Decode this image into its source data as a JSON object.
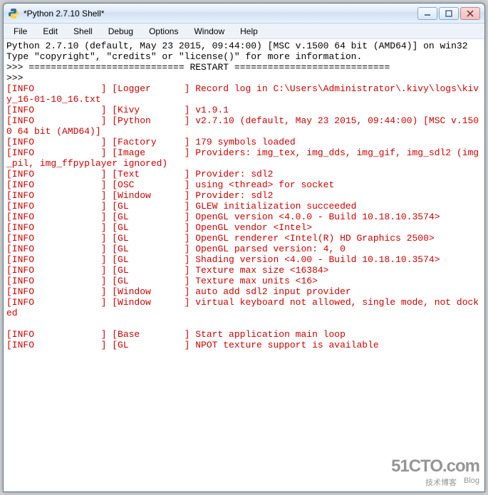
{
  "window": {
    "title": "*Python 2.7.10 Shell*"
  },
  "menu": {
    "items": [
      "File",
      "Edit",
      "Shell",
      "Debug",
      "Options",
      "Window",
      "Help"
    ]
  },
  "console": {
    "header1": "Python 2.7.10 (default, May 23 2015, 09:44:00) [MSC v.1500 64 bit (AMD64)] on win32",
    "header2": "Type \"copyright\", \"credits\" or \"license()\" for more information.",
    "restart": ">>> ============================ RESTART ============================",
    "prompt": ">>> ",
    "lines": [
      "[INFO            ] [Logger      ] Record log in C:\\Users\\Administrator\\.kivy\\logs\\kivy_16-01-10_16.txt",
      "[INFO            ] [Kivy        ] v1.9.1",
      "[INFO            ] [Python      ] v2.7.10 (default, May 23 2015, 09:44:00) [MSC v.1500 64 bit (AMD64)]",
      "[INFO            ] [Factory     ] 179 symbols loaded",
      "[INFO            ] [Image       ] Providers: img_tex, img_dds, img_gif, img_sdl2 (img_pil, img_ffpyplayer ignored)",
      "[INFO            ] [Text        ] Provider: sdl2",
      "[INFO            ] [OSC         ] using <thread> for socket",
      "[INFO            ] [Window      ] Provider: sdl2",
      "[INFO            ] [GL          ] GLEW initialization succeeded",
      "[INFO            ] [GL          ] OpenGL version <4.0.0 - Build 10.18.10.3574>",
      "[INFO            ] [GL          ] OpenGL vendor <Intel>",
      "[INFO            ] [GL          ] OpenGL renderer <Intel(R) HD Graphics 2500>",
      "[INFO            ] [GL          ] OpenGL parsed version: 4, 0",
      "[INFO            ] [GL          ] Shading version <4.00 - Build 10.18.10.3574>",
      "[INFO            ] [GL          ] Texture max size <16384>",
      "[INFO            ] [GL          ] Texture max units <16>",
      "[INFO            ] [Window      ] auto add sdl2 input provider",
      "[INFO            ] [Window      ] virtual keyboard not allowed, single mode, not docked",
      "",
      "[INFO            ] [Base        ] Start application main loop",
      "[INFO            ] [GL          ] NPOT texture support is available"
    ]
  },
  "watermark": {
    "main": "51CTO.com",
    "sub1": "技术博客",
    "sub2": "Blog"
  }
}
